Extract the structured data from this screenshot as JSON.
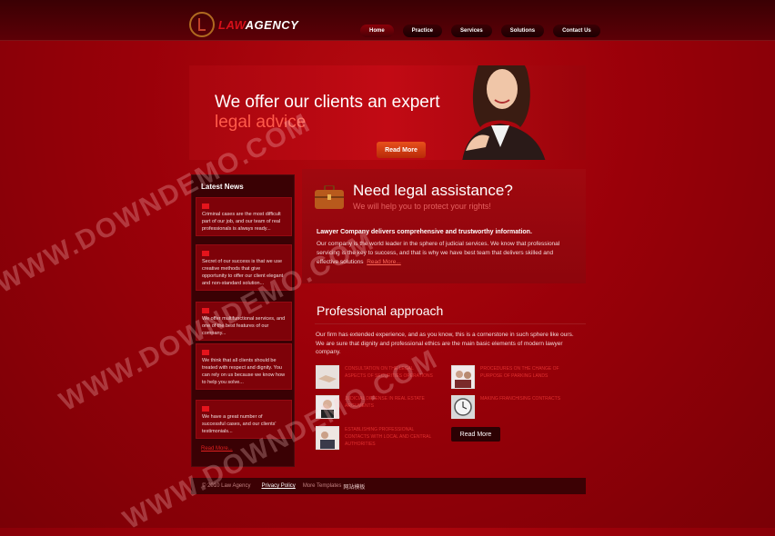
{
  "header": {
    "logo_law": "LAW",
    "logo_agency": "AGENCY",
    "nav": [
      "Home",
      "Practice",
      "Services",
      "Solutions",
      "Contact Us"
    ]
  },
  "hero": {
    "line1": "We offer our clients an expert",
    "line2": "legal advice",
    "button": "Read More"
  },
  "news": {
    "title": "Latest News",
    "items": [
      {
        "text": "Criminal cases are the most difficult part of our job, and our team of real professionals is always ready..."
      },
      {
        "text": "Secret of our success is that we use creative methods that give opportunity to offer our client elegant and non-standard solution..."
      },
      {
        "text": "We offer multifunctional services, and one of the best features of our company..."
      },
      {
        "text": "We think that all clients should be treated with respect and dignity. You can rely on us because we know how to help you solve..."
      },
      {
        "text": "We have a great number of successful cases, and our clients' testimonials..."
      }
    ],
    "more": "Read More..."
  },
  "assist": {
    "title": "Need legal assistance?",
    "subtitle": "We will help you to protect your rights!",
    "lead": "Lawyer Company delivers comprehensive and trustworthy information.",
    "body": "Our company is the world leader in the sphere of judicial services. We know that professional servicing is the key to success, and that is why we have best team that delivers skilled and effective solutions",
    "read_more": "Read More..."
  },
  "approach": {
    "title": "Professional approach",
    "body": "Our firm has extended experience, and as you know, this is a cornerstone in such sphere like ours. We are sure that dignity and professional ethics are the main basic elements of modern lawyer company.",
    "services": [
      {
        "label": "Consultation on the legal aspects of securities operations"
      },
      {
        "label": "Procedures on the change of purpose of parking lands"
      },
      {
        "label": "Judicial defense in real estate arguments"
      },
      {
        "label": "Making franchising contracts"
      },
      {
        "label": "Establishing professional contacts with local and central authorities"
      }
    ],
    "button": "Read More"
  },
  "footer": {
    "copyright": "© 2010 Law Agency",
    "privacy": "Privacy Policy",
    "extra": "More Templates",
    "extra2": "网站模板"
  },
  "watermark": "WWW.DOWNDEMO.COM"
}
